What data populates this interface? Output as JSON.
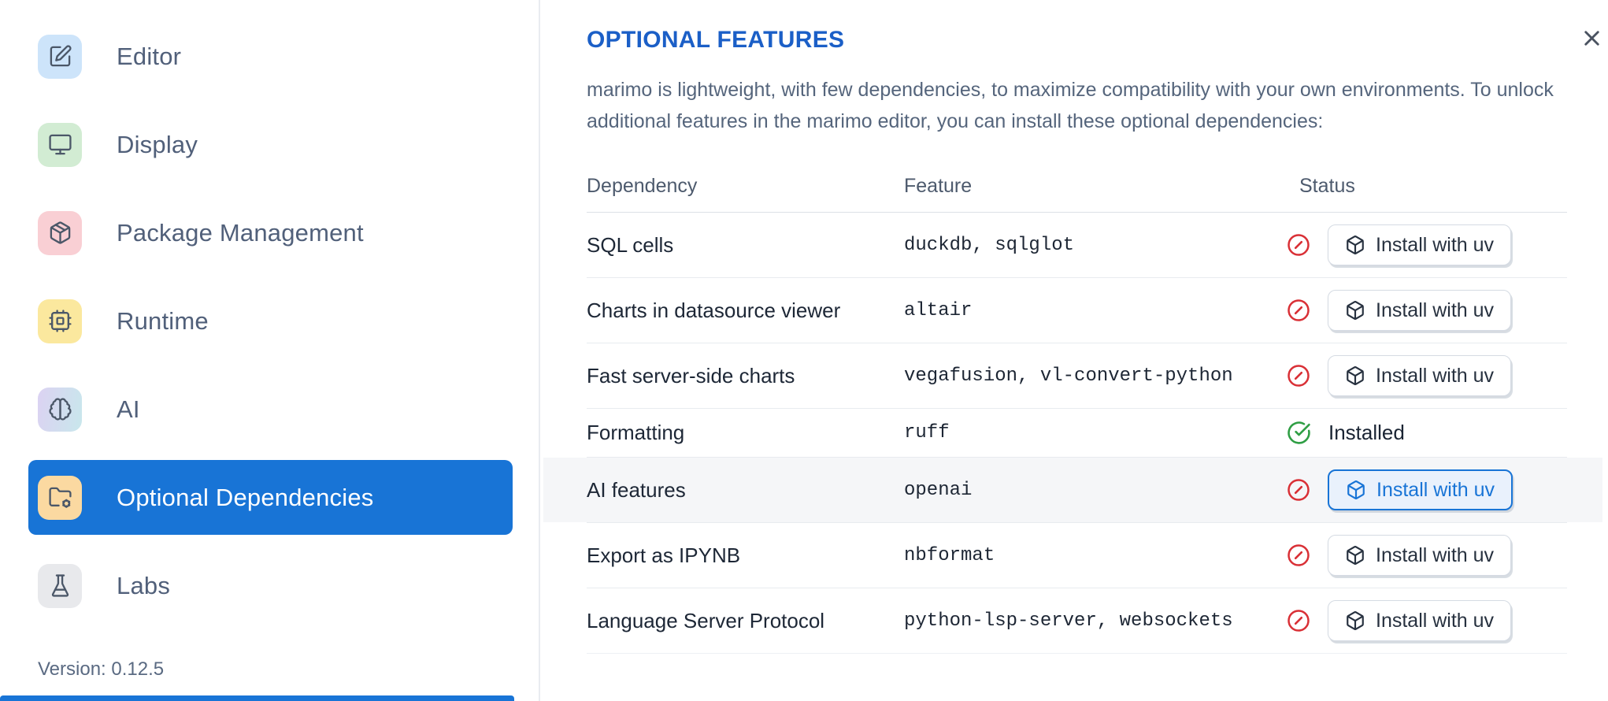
{
  "sidebar": {
    "items": [
      {
        "label": "Editor",
        "icon": "square-pen",
        "tile_bg": "#cde4fa"
      },
      {
        "label": "Display",
        "icon": "monitor",
        "tile_bg": "#d2ecd3"
      },
      {
        "label": "Package Management",
        "icon": "package",
        "tile_bg": "#f9cfd4"
      },
      {
        "label": "Runtime",
        "icon": "cpu",
        "tile_bg": "#fbe89e"
      },
      {
        "label": "AI",
        "icon": "brain",
        "tile_bg": "#dcd2f2",
        "tile_bg2": "#c8e7ec"
      },
      {
        "label": "Optional Dependencies",
        "icon": "folder-cog",
        "tile_bg": "#fbd9a1",
        "selected": true
      },
      {
        "label": "Labs",
        "icon": "flask-conical",
        "tile_bg": "#e8e9ec"
      }
    ],
    "version_label": "Version: 0.12.5"
  },
  "panel": {
    "title": "OPTIONAL FEATURES",
    "description": "marimo is lightweight, with few dependencies, to maximize compatibility with your own environments. To unlock additional features in the marimo editor, you can install these optional dependencies:",
    "close_icon": "x"
  },
  "table": {
    "headers": [
      "Dependency",
      "Feature",
      "Status"
    ],
    "install_button_label": "Install with uv",
    "install_button_icon": "box",
    "installed_label": "Installed",
    "status_error_icon": "circle-x",
    "status_ok_icon": "circle-check",
    "rows": [
      {
        "dependency": "SQL cells",
        "feature": "duckdb, sqlglot",
        "installed": false
      },
      {
        "dependency": "Charts in datasource viewer",
        "feature": "altair",
        "installed": false
      },
      {
        "dependency": "Fast server-side charts",
        "feature": "vegafusion, vl-convert-python",
        "installed": false
      },
      {
        "dependency": "Formatting",
        "feature": "ruff",
        "installed": true
      },
      {
        "dependency": "AI features",
        "feature": "openai",
        "installed": false,
        "focused": true
      },
      {
        "dependency": "Export as IPYNB",
        "feature": "nbformat",
        "installed": false
      },
      {
        "dependency": "Language Server Protocol",
        "feature": "python-lsp-server, websockets",
        "installed": false
      }
    ]
  },
  "colors": {
    "accent": "#1874d6",
    "title": "#1b5fc7",
    "error": "#d93036",
    "success": "#2f9e44"
  }
}
